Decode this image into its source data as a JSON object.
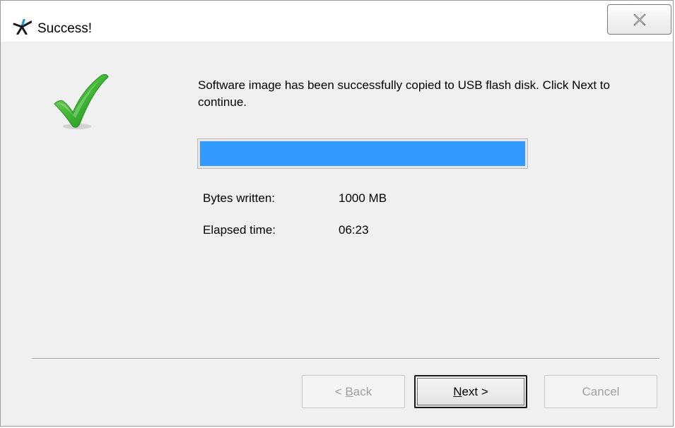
{
  "window": {
    "title": "Success!",
    "close_icon": "close-icon"
  },
  "content": {
    "message": "Software image has been successfully copied to USB flash disk.  Click Next to continue.",
    "progress": 1.0,
    "progress_color": "#3399ff",
    "bytes_written_label": "Bytes written:",
    "bytes_written_value": "1000 MB",
    "elapsed_time_label": "Elapsed time:",
    "elapsed_time_value": "06:23"
  },
  "buttons": {
    "back": {
      "prefix": "< ",
      "mnemonic": "B",
      "rest": "ack"
    },
    "next": {
      "mnemonic": "N",
      "rest": "ext >"
    },
    "cancel": "Cancel"
  }
}
